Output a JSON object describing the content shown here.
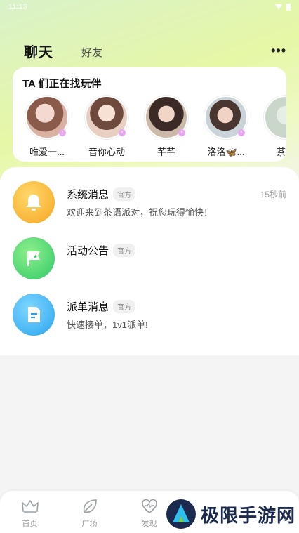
{
  "status_bar": {
    "time": "11:13"
  },
  "header": {
    "tabs": [
      {
        "label": "聊天",
        "active": true
      },
      {
        "label": "好友",
        "active": false
      }
    ],
    "more_icon": "more-dots-icon"
  },
  "find_partner": {
    "title": "TA 们正在找玩伴",
    "users": [
      {
        "name": "唯爱一...",
        "gender": "female"
      },
      {
        "name": "音你心动",
        "gender": "female"
      },
      {
        "name": "芊芊",
        "gender": "female"
      },
      {
        "name": "洛洛🦋...",
        "gender": "female"
      },
      {
        "name": "茶语",
        "gender": "female"
      }
    ]
  },
  "messages": [
    {
      "title": "系统消息",
      "badge": "官方",
      "text": "欢迎来到茶语派对，祝您玩得愉快！",
      "time": "15秒前",
      "icon": "bell-icon",
      "color": "#f6a623"
    },
    {
      "title": "活动公告",
      "badge": "官方",
      "text": "",
      "time": "",
      "icon": "flag-star-icon",
      "color": "#30c867"
    },
    {
      "title": "派单消息",
      "badge": "官方",
      "text": "快速接单，1v1派单!",
      "time": "",
      "icon": "document-icon",
      "color": "#2aa3ee"
    }
  ],
  "bottom_nav": [
    {
      "label": "首页",
      "icon": "crown-icon"
    },
    {
      "label": "广场",
      "icon": "leaf-icon"
    },
    {
      "label": "发现",
      "icon": "heart-pulse-icon"
    }
  ],
  "watermark": {
    "text": "极限手游网"
  },
  "colors": {
    "accent": "#b8ec3e",
    "background": "#f4f4f4"
  }
}
